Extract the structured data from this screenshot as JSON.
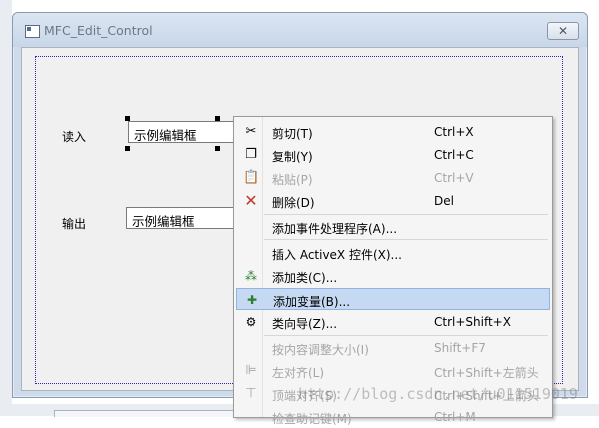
{
  "dialog": {
    "title": "MFC_Edit_Control",
    "close_glyph": "✕"
  },
  "form": {
    "input_label": "读入",
    "input_value": "示例编辑框",
    "output_label": "输出",
    "output_value": "示例编辑框"
  },
  "context_menu": {
    "items": [
      {
        "label": "剪切(T)",
        "shortcut": "Ctrl+X",
        "icon": "scissors-icon",
        "enabled": true
      },
      {
        "label": "复制(Y)",
        "shortcut": "Ctrl+C",
        "icon": "copy-icon",
        "enabled": true
      },
      {
        "label": "粘贴(P)",
        "shortcut": "Ctrl+V",
        "icon": "paste-icon",
        "enabled": false
      },
      {
        "label": "删除(D)",
        "shortcut": "Del",
        "icon": "delete-x-icon",
        "enabled": true
      },
      {
        "label": "添加事件处理程序(A)...",
        "shortcut": "",
        "icon": "",
        "enabled": true
      },
      {
        "label": "插入 ActiveX 控件(X)...",
        "shortcut": "",
        "icon": "",
        "enabled": true
      },
      {
        "label": "添加类(C)...",
        "shortcut": "",
        "icon": "add-class-icon",
        "enabled": true
      },
      {
        "label": "添加变量(B)...",
        "shortcut": "",
        "icon": "add-variable-icon",
        "enabled": true,
        "highlighted": true
      },
      {
        "label": "类向导(Z)...",
        "shortcut": "Ctrl+Shift+X",
        "icon": "class-wizard-icon",
        "enabled": true
      },
      {
        "label": "按内容调整大小(I)",
        "shortcut": "Shift+F7",
        "icon": "",
        "enabled": false
      },
      {
        "label": "左对齐(L)",
        "shortcut": "Ctrl+Shift+左箭头",
        "icon": "align-left-icon",
        "enabled": false
      },
      {
        "label": "顶端对齐(S)",
        "shortcut": "Ctrl+Shift+上箭头",
        "icon": "align-top-icon",
        "enabled": false
      },
      {
        "label": "检查助记键(M)",
        "shortcut": "Ctrl+M",
        "icon": "",
        "enabled": false
      }
    ]
  },
  "watermark": "http://blog.csdn.net/u011519019",
  "colors": {
    "highlight": "#c6d9f2",
    "guide": "#2a2aa8",
    "delete_red": "#c0392b"
  }
}
